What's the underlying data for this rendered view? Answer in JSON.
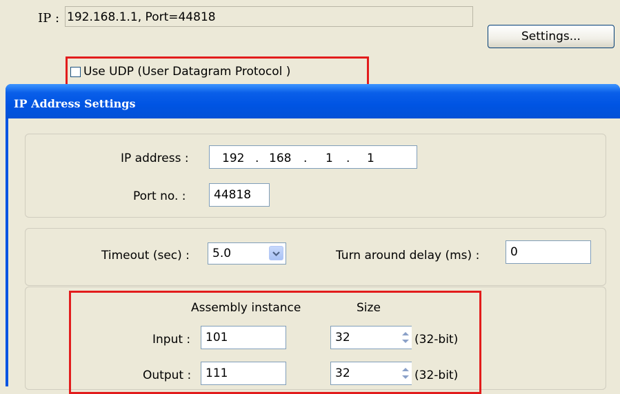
{
  "top": {
    "ip_label": "IP :",
    "ip_summary": "192.168.1.1,  Port=44818",
    "settings_button": "Settings...",
    "udp_checkbox_label": "Use UDP (User Datagram Protocol )",
    "udp_checked": false
  },
  "dialog": {
    "title": "IP Address Settings",
    "ip_address_label": "IP address :",
    "ip_octets": [
      "192",
      "168",
      "1",
      "1"
    ],
    "port_label": "Port no. :",
    "port_value": "44818",
    "timeout_label": "Timeout (sec) :",
    "timeout_value": "5.0",
    "turn_around_label": "Turn around delay (ms) :",
    "turn_around_value": "0",
    "assembly_header": "Assembly instance",
    "size_header": "Size",
    "input_label": "Input :",
    "input_instance": "101",
    "input_size": "32",
    "input_size_unit": "(32-bit)",
    "output_label": "Output :",
    "output_instance": "111",
    "output_size": "32",
    "output_size_unit": "(32-bit)"
  },
  "colors": {
    "highlight": "#e21c1c",
    "titlebar": "#0054e3",
    "window_bg": "#ece9d8"
  }
}
